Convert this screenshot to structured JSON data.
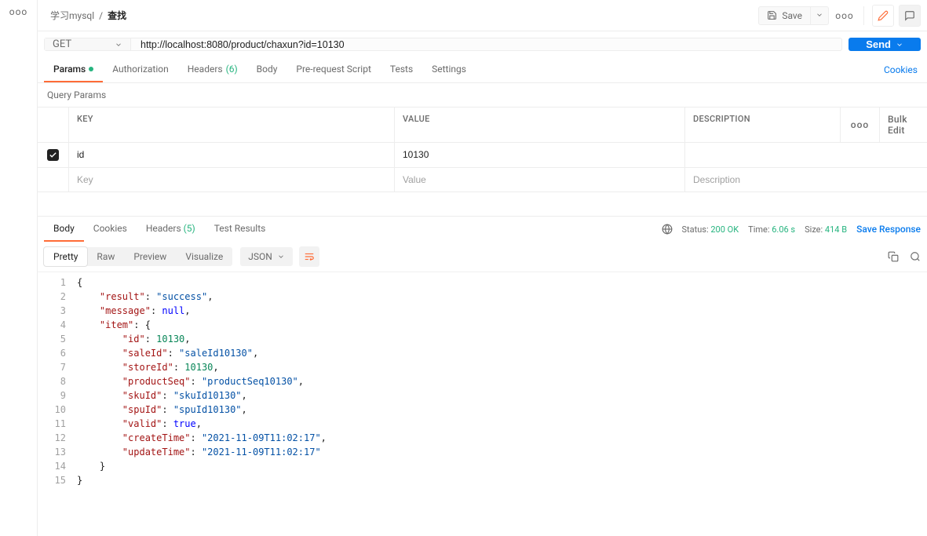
{
  "breadcrumb": {
    "collection": "学习mysql",
    "sep": "/",
    "request": "查找"
  },
  "topbar": {
    "save": "Save"
  },
  "request": {
    "method": "GET",
    "url": "http://localhost:8080/product/chaxun?id=10130",
    "send": "Send"
  },
  "req_tabs": {
    "params": "Params",
    "auth": "Authorization",
    "headers": "Headers",
    "headers_count": "(6)",
    "body": "Body",
    "prerequest": "Pre-request Script",
    "tests": "Tests",
    "settings": "Settings",
    "cookies": "Cookies"
  },
  "query_params_label": "Query Params",
  "params_header": {
    "key": "KEY",
    "value": "VALUE",
    "desc": "DESCRIPTION",
    "bulk": "Bulk Edit"
  },
  "params_row": {
    "key": "id",
    "value": "10130",
    "desc": ""
  },
  "params_placeholder": {
    "key": "Key",
    "value": "Value",
    "desc": "Description"
  },
  "resp_tabs": {
    "body": "Body",
    "cookies": "Cookies",
    "headers": "Headers",
    "headers_count": "(5)",
    "tests": "Test Results"
  },
  "resp_meta": {
    "status_label": "Status:",
    "status_value": "200 OK",
    "time_label": "Time:",
    "time_value": "6.06 s",
    "size_label": "Size:",
    "size_value": "414 B",
    "save_response": "Save Response"
  },
  "viewer": {
    "pretty": "Pretty",
    "raw": "Raw",
    "preview": "Preview",
    "visualize": "Visualize",
    "format": "JSON"
  },
  "json_body": {
    "result": "success",
    "message": null,
    "item": {
      "id": 10130,
      "saleId": "saleId10130",
      "storeId": 10130,
      "productSeq": "productSeq10130",
      "skuId": "skuId10130",
      "spuId": "spuId10130",
      "valid": true,
      "createTime": "2021-11-09T11:02:17",
      "updateTime": "2021-11-09T11:02:17"
    }
  }
}
